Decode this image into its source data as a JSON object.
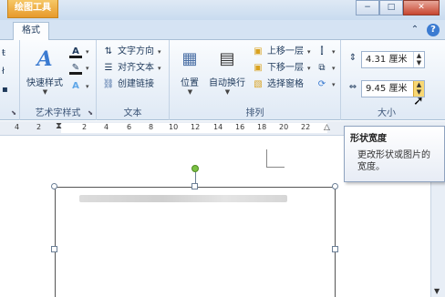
{
  "context_tab_group": "绘图工具",
  "window_buttons": {
    "minimize": "−",
    "restore": "□",
    "close": "✕"
  },
  "tabs": {
    "active": "格式"
  },
  "tabrow_icons": {
    "collapse": "⌃",
    "help": "?"
  },
  "ribbon": {
    "left_partial": {
      "items": [
        "ŧ",
        "ł",
        "▪"
      ]
    },
    "wordart": {
      "quick_styles_label": "快速样式",
      "group_label": "艺术字样式",
      "text_fill_icon": "A",
      "text_outline_icon": "✎",
      "text_effects_icon": "A"
    },
    "text": {
      "direction_label": "文字方向",
      "align_label": "对齐文本",
      "link_label": "创建链接",
      "group_label": "文本"
    },
    "arrange": {
      "position_label": "位置",
      "wrap_label": "自动换行",
      "bring_forward_label": "上移一层",
      "send_backward_label": "下移一层",
      "selection_pane_label": "选择窗格",
      "group_label": "排列"
    },
    "size": {
      "height_value": "4.31 厘米",
      "width_value": "9.45 厘米",
      "group_label": "大小"
    }
  },
  "ruler_ticks": [
    "4",
    "2",
    "2",
    "4",
    "6",
    "8",
    "10",
    "12",
    "14",
    "16",
    "18",
    "20",
    "22"
  ],
  "tooltip": {
    "title": "形状宽度",
    "description": "更改形状或图片的宽度。"
  }
}
